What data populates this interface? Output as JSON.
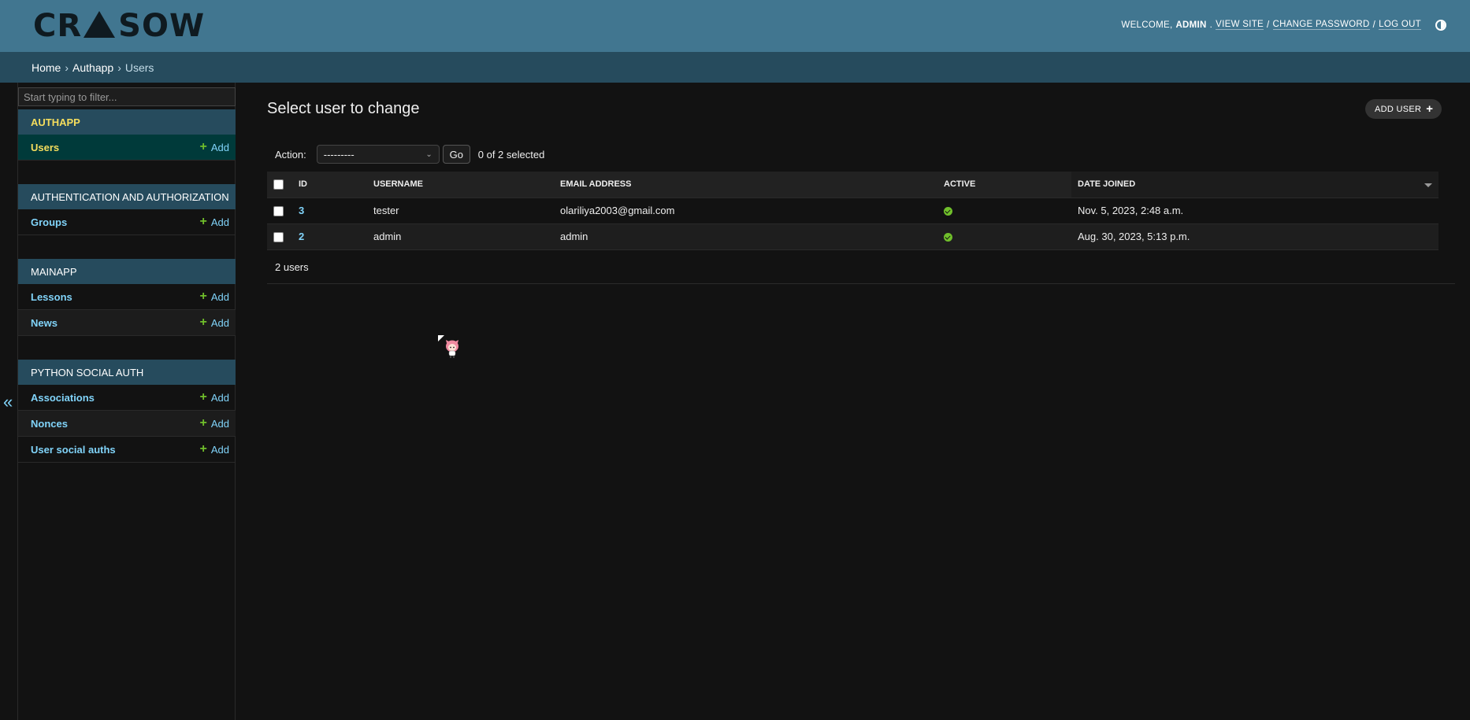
{
  "header": {
    "logo_left": "CR",
    "logo_right": "SOW",
    "welcome": "WELCOME,",
    "user": "ADMIN",
    "view_site": "VIEW SITE",
    "change_password": "CHANGE PASSWORD",
    "log_out": "LOG OUT",
    "separator": "/",
    "theme_icon": "theme-toggle-icon"
  },
  "breadcrumbs": {
    "home": "Home",
    "app": "Authapp",
    "current": "Users",
    "separator": "›"
  },
  "sidebar": {
    "filter_placeholder": "Start typing to filter...",
    "add_label": "Add",
    "collapse_label": "«",
    "modules": [
      {
        "name": "AUTHAPP",
        "models": [
          {
            "label": "Users"
          }
        ]
      },
      {
        "name": "AUTHENTICATION AND AUTHORIZATION",
        "models": [
          {
            "label": "Groups"
          }
        ]
      },
      {
        "name": "MAINAPP",
        "models": [
          {
            "label": "Lessons"
          },
          {
            "label": "News"
          }
        ]
      },
      {
        "name": "PYTHON SOCIAL AUTH",
        "models": [
          {
            "label": "Associations"
          },
          {
            "label": "Nonces"
          },
          {
            "label": "User social auths"
          }
        ]
      }
    ]
  },
  "content": {
    "title": "Select user to change",
    "add_button": "ADD USER",
    "add_icon": "+",
    "action_label": "Action:",
    "action_selected": "---------",
    "go_label": "Go",
    "selection_counter": "0 of 2 selected",
    "result_count": "2 users"
  },
  "table": {
    "columns": [
      "ID",
      "USERNAME",
      "EMAIL ADDRESS",
      "ACTIVE",
      "DATE JOINED"
    ],
    "rows": [
      {
        "id": "3",
        "username": "tester",
        "email": "olariliya2003@gmail.com",
        "active": true,
        "date_joined": "Nov. 5, 2023, 2:48 a.m."
      },
      {
        "id": "2",
        "username": "admin",
        "email": "admin",
        "active": true,
        "date_joined": "Aug. 30, 2023, 5:13 p.m."
      }
    ]
  },
  "colors": {
    "header": "#417690",
    "breadcrumbs": "#264b5d",
    "accent_link": "#81d4fa",
    "current_highlight": "#f5dd5d",
    "success": "#70bf2b",
    "background": "#121212"
  }
}
